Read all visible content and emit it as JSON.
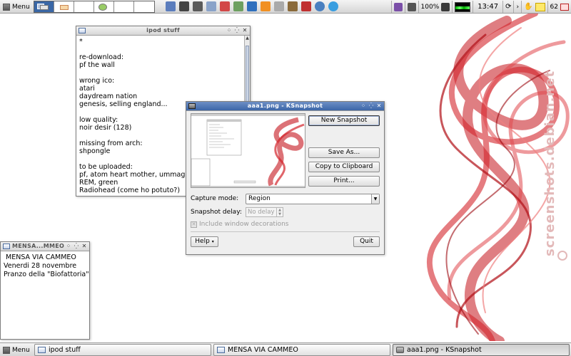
{
  "top_panel": {
    "menu_label": "Menu",
    "battery": "100%",
    "clock": "13:47",
    "mail_count": "62",
    "launcher_icons": [
      "package-manager-icon",
      "terminal-icon",
      "monitor-icon",
      "image-viewer-icon",
      "network-icon",
      "gaim-icon",
      "vlc-icon",
      "keyboard-icon",
      "file-manager-icon",
      "music-icon",
      "browser-icon",
      "skype-icon"
    ]
  },
  "windows": {
    "ipod": {
      "title": "ipod stuff",
      "content": "*\n\nre-download:\npf the wall\n\nwrong ico:\natari\ndaydream nation\ngenesis, selling england...\n\nlow quality:\nnoir desir (128)\n\nmissing from arch:\nshpongle\n\nto be uploaded:\npf, atom heart mother, ummagumma\nREM, green\nRadiohead (come ho potuto?)"
    },
    "mensa": {
      "title": "MENSA...MMEO",
      "content": " MENSA VIA CAMMEO\nVenerdi 28 novembre\nPranzo della \"Biofattoria\""
    },
    "ksnapshot": {
      "title": "aaa1.png - KSnapshot",
      "buttons": {
        "new_snapshot": "New Snapshot",
        "save_as": "Save As...",
        "copy_clipboard": "Copy to Clipboard",
        "print": "Print...",
        "help": "Help",
        "quit": "Quit"
      },
      "capture_mode_label": "Capture mode:",
      "capture_mode_value": "Region",
      "snapshot_delay_label": "Snapshot delay:",
      "snapshot_delay_value": "No delay",
      "include_decorations_label": "Include window decorations"
    }
  },
  "wallpaper": {
    "watermark": "screenshots.debian.net"
  },
  "taskbar": {
    "menu_label": "Menu",
    "tasks": [
      {
        "label": "ipod stuff"
      },
      {
        "label": "MENSA VIA CAMMEO"
      },
      {
        "label": "aaa1.png - KSnapshot"
      }
    ]
  },
  "colors": {
    "accent_titlebar": "#3c66a8",
    "smoke_red": "#c4141c"
  }
}
